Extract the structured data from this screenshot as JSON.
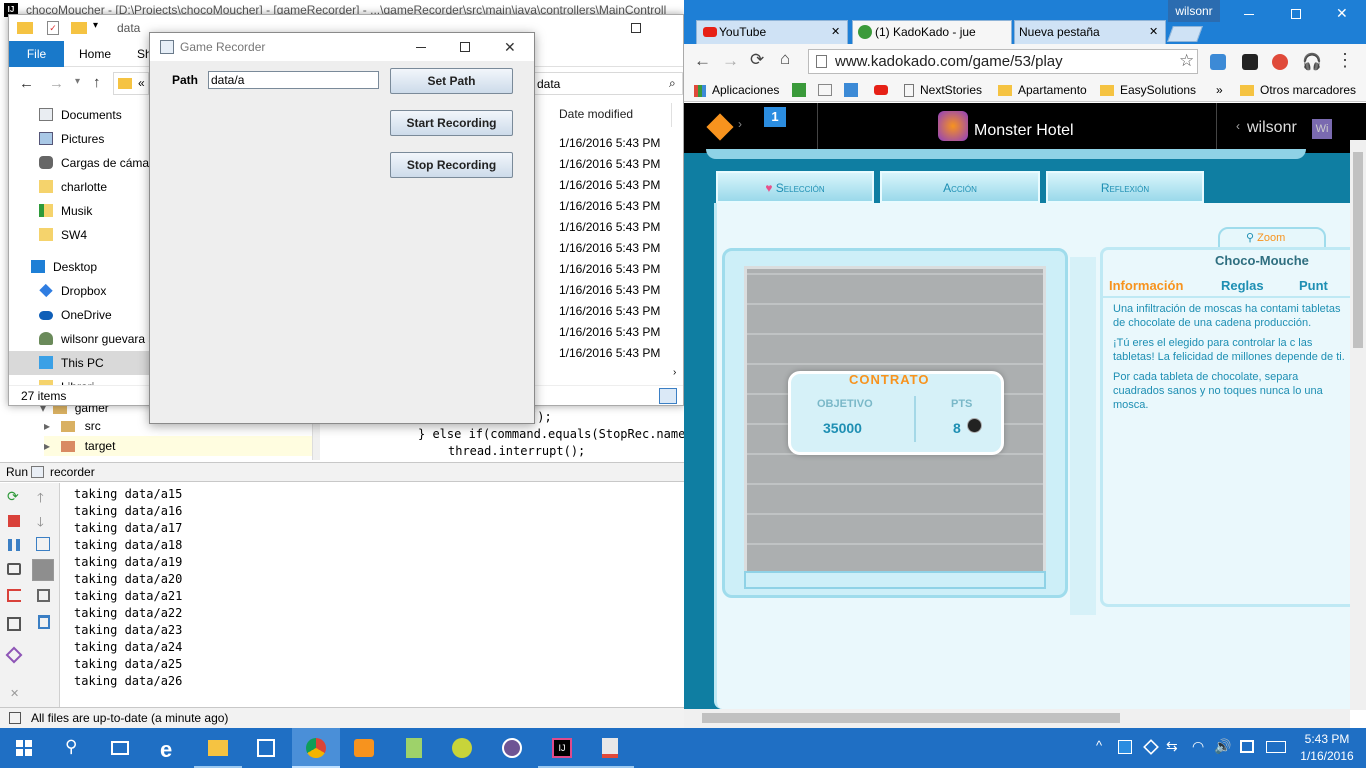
{
  "ide": {
    "title": "chocoMoucher - [D:\\Projects\\chocoMoucher] - [gameRecorder] - ...\\gameRecorder\\src\\main\\java\\controllers\\MainControll",
    "tree": [
      {
        "label": "gamer",
        "depth": 0
      },
      {
        "label": "src",
        "depth": 1
      },
      {
        "label": "target",
        "depth": 1
      }
    ],
    "code_lines": [
      "();",
      "} else if(command.equals(StopRec.name",
      "thread.interrupt();"
    ],
    "run_label": "Run",
    "run_config": "recorder",
    "console_lines": [
      "taking data/a15",
      "taking data/a16",
      "taking data/a17",
      "taking data/a18",
      "taking data/a19",
      "taking data/a20",
      "taking data/a21",
      "taking data/a22",
      "taking data/a23",
      "taking data/a24",
      "taking data/a25",
      "taking data/a26"
    ],
    "status": "All files are up-to-date (a minute ago)"
  },
  "explorer": {
    "title": "data",
    "tabs": [
      "File",
      "Home",
      "Sh"
    ],
    "crumb": "data",
    "nav": [
      "Documents",
      "Pictures",
      "Cargas de cámara",
      "charlotte",
      "Musik",
      "SW4",
      "Desktop",
      "Dropbox",
      "OneDrive",
      "wilsonr guevara a",
      "This PC",
      "Librari"
    ],
    "header_date": "Date modified",
    "dates": [
      "1/16/2016 5:43 PM",
      "1/16/2016 5:43 PM",
      "1/16/2016 5:43 PM",
      "1/16/2016 5:43 PM",
      "1/16/2016 5:43 PM",
      "1/16/2016 5:43 PM",
      "1/16/2016 5:43 PM",
      "1/16/2016 5:43 PM",
      "1/16/2016 5:43 PM",
      "1/16/2016 5:43 PM",
      "1/16/2016 5:43 PM"
    ],
    "item_count": "27 items"
  },
  "recorder": {
    "title": "Game Recorder",
    "path_label": "Path",
    "path_value": "data/a",
    "set_path": "Set Path",
    "start": "Start Recording",
    "stop": "Stop Recording"
  },
  "chrome": {
    "user": "wilsonr",
    "tabs": [
      "YouTube",
      "(1) KadoKado - jue",
      "Nueva pestaña"
    ],
    "url": "www.kadokado.com/game/53/play",
    "bookmarks": [
      "Aplicaciones",
      "NextStories",
      "Apartamento",
      "EasySolutions",
      "»",
      "Otros marcadores"
    ],
    "kk_badge": "1",
    "kk_game": "Monster Hotel",
    "kk_user": "wilsonr",
    "kk_user_badge": "Wi"
  },
  "game": {
    "tabs": [
      "Selección",
      "Acción",
      "Reflexión"
    ],
    "zoom": "Zoom",
    "panel_title": "Choco-Mouche",
    "panel_tabs": [
      "Información",
      "Reglas",
      "Punt"
    ],
    "info_paragraphs": [
      "Una infiltración de moscas ha contami tabletas de chocolate de una cadena producción.",
      "¡Tú eres el elegido para controlar la c las tabletas! La felicidad de millones depende de ti.",
      "Por cada tableta de chocolate, separa cuadrados sanos y no toques nunca lo una mosca."
    ],
    "contract": "CONTRATO",
    "objective_label": "OBJETIVO",
    "objective_value": "35000",
    "pts_label": "PTS",
    "pts_value": "8"
  },
  "taskbar": {
    "time": "5:43 PM",
    "date": "1/16/2016"
  },
  "colors": {
    "taskbar": "#1f6fc4",
    "chrome_frame": "#1e7fd6",
    "game_bg": "#0f7ea2",
    "orange": "#f7931e"
  }
}
